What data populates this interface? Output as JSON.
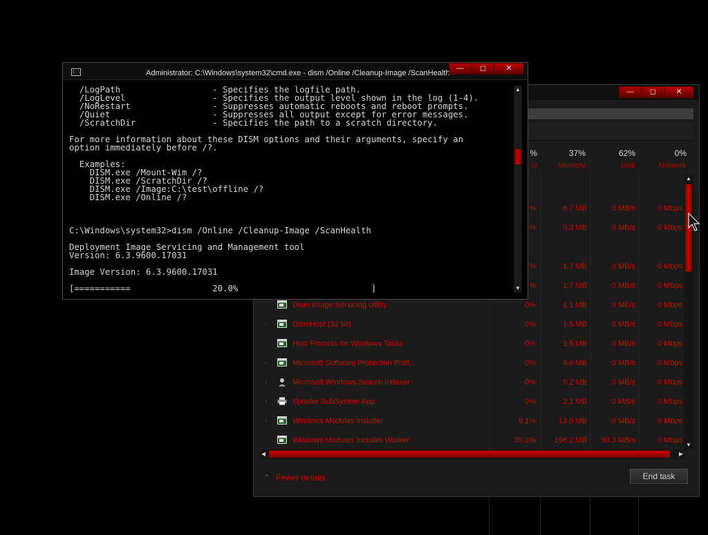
{
  "colors": {
    "accent": "#d40000",
    "accent_dark": "#7a0000",
    "background": "#000000",
    "panel": "#1b1b1b",
    "text": "#d6d6d6"
  },
  "cmd": {
    "title": "Administrator: C:\\Windows\\system32\\cmd.exe - dism  /Online /Cleanup-Image /ScanHealth",
    "icon": "cmd-icon",
    "controls": {
      "minimize": "—",
      "maximize": "◻",
      "close": "✕"
    },
    "lines": [
      "  /LogPath                  - Specifies the logfile path.",
      "  /LogLevel                 - Specifies the output level shown in the log (1-4).",
      "  /NoRestart                - Suppresses automatic reboots and reboot prompts.",
      "  /Quiet                    - Suppresses all output except for error messages.",
      "  /ScratchDir               - Specifies the path to a scratch directory.",
      "",
      "For more information about these DISM options and their arguments, specify an",
      "option immediately before /?.",
      "",
      "  Examples:",
      "    DISM.exe /Mount-Wim /?",
      "    DISM.exe /ScratchDir /?",
      "    DISM.exe /Image:C:\\test\\offline /?",
      "    DISM.exe /Online /?",
      "",
      "",
      "",
      "C:\\Windows\\system32>dism /Online /Cleanup-Image /ScanHealth",
      "",
      "Deployment Image Servicing and Management tool",
      "Version: 6.3.9600.17031",
      "",
      "Image Version: 6.3.9600.17031",
      "",
      "[===========                20.0%                          ]"
    ]
  },
  "taskmanager": {
    "controls": {
      "minimize": "—",
      "maximize": "◻",
      "close": "✕"
    },
    "columns": {
      "cpu": {
        "pct": "%",
        "label": "U"
      },
      "memory": {
        "pct": "37%",
        "label": "Memory"
      },
      "disk": {
        "pct": "62%",
        "label": "Disk"
      },
      "network": {
        "pct": "0%",
        "label": "Network"
      }
    },
    "rows": [
      {
        "name": "",
        "cpu": "%",
        "memory": "6.7 MB",
        "disk": "0 MB/s",
        "network": "0 Mbps",
        "icon": "",
        "expandable": false
      },
      {
        "name": "",
        "cpu": "%",
        "memory": "0.3 MB",
        "disk": "0 MB/s",
        "network": "0 Mbps",
        "icon": "",
        "expandable": false
      },
      {
        "name": "",
        "cpu": "",
        "memory": "",
        "disk": "",
        "network": "",
        "icon": "",
        "expandable": false
      },
      {
        "name": "",
        "cpu": "%",
        "memory": "1.7 MB",
        "disk": "0 MB/s",
        "network": "0 Mbps",
        "icon": "",
        "expandable": false
      },
      {
        "name": "",
        "cpu": "%",
        "memory": "1.7 MB",
        "disk": "0 MB/s",
        "network": "0 Mbps",
        "icon": "",
        "expandable": false
      },
      {
        "name": "Dism Image Servicing Utility",
        "cpu": "0%",
        "memory": "1.1 MB",
        "disk": "0 MB/s",
        "network": "0 Mbps",
        "icon": "app-window-icon",
        "expandable": false
      },
      {
        "name": "DismHost (32 bit)",
        "cpu": "0%",
        "memory": "1.5 MB",
        "disk": "0 MB/s",
        "network": "0 Mbps",
        "icon": "app-window-icon",
        "expandable": true
      },
      {
        "name": "Host Process for Windows Tasks",
        "cpu": "0%",
        "memory": "1.5 MB",
        "disk": "0 MB/s",
        "network": "0 Mbps",
        "icon": "app-window-icon",
        "expandable": false
      },
      {
        "name": "Microsoft Software Protection Platf...",
        "cpu": "0%",
        "memory": "4.6 MB",
        "disk": "0 MB/s",
        "network": "0 Mbps",
        "icon": "app-window-icon",
        "expandable": true
      },
      {
        "name": "Microsoft Windows Search Indexer",
        "cpu": "0%",
        "memory": "5.2 MB",
        "disk": "0 MB/s",
        "network": "0 Mbps",
        "icon": "search-indexer-icon",
        "expandable": true
      },
      {
        "name": "Spooler SubSystem App",
        "cpu": "0%",
        "memory": "2.1 MB",
        "disk": "0 MB/s",
        "network": "0 Mbps",
        "icon": "printer-icon",
        "expandable": true
      },
      {
        "name": "Windows Modules Installer",
        "cpu": "9.1%",
        "memory": "13.0 MB",
        "disk": "0 MB/s",
        "network": "0 Mbps",
        "icon": "app-window-icon",
        "expandable": true
      },
      {
        "name": "Windows Modules Installer Worker",
        "cpu": "39.2%",
        "memory": "196.2 MB",
        "disk": "60.3 MB/s",
        "network": "0 Mbps",
        "icon": "app-window-icon",
        "expandable": false
      }
    ],
    "fewer_details": "Fewer details",
    "end_task": "End task"
  }
}
